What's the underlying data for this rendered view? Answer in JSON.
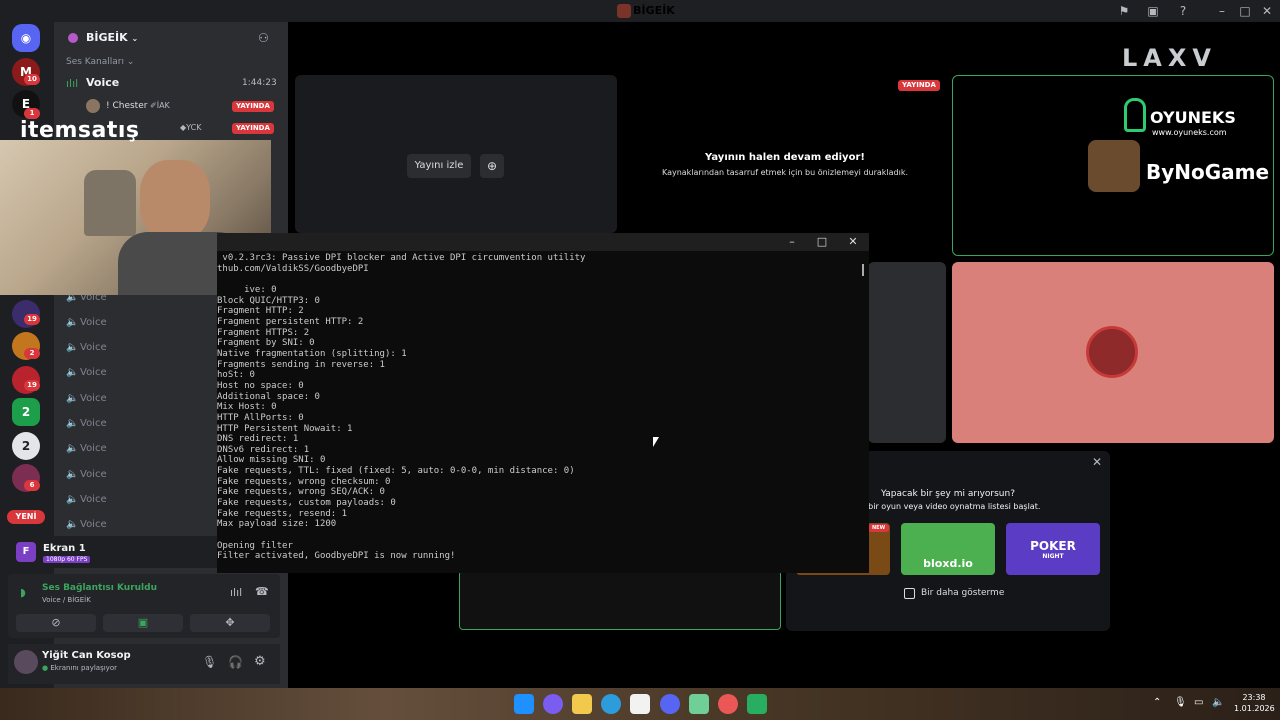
{
  "window": {
    "title": "BİGEİK"
  },
  "rail": {
    "badges": [
      "10",
      "1",
      "19",
      "2",
      "19",
      "2",
      "6"
    ],
    "new_label": "YENİ",
    "e_label": "E",
    "f_label": "F"
  },
  "sidebar": {
    "server_name": "BİGEİK",
    "section": "Ses Kanalları",
    "voice_main": "Voice",
    "timer": "1:44:23",
    "members": [
      {
        "name": "! Chester",
        "tag": "İAK",
        "badge": "YAYINDA"
      },
      {
        "tag": "YCK",
        "badge": "YAYINDA"
      }
    ],
    "voice_channels": [
      "Voice",
      "Voice",
      "Voice",
      "Voice",
      "Voice",
      "Voice",
      "Voice",
      "Voice",
      "Voice",
      "Voice"
    ]
  },
  "stream_card": {
    "title": "Ekran 1",
    "quality": "1080p 60 FPS"
  },
  "connection": {
    "status": "Ses Bağlantısı Kuruldu",
    "location": "Voice / BİGEİK"
  },
  "user": {
    "name": "Yiğit Can Kosop",
    "status": "Ekranını paylaşıyor"
  },
  "webcam_overlay": {
    "logo": "itemsatış"
  },
  "stage": {
    "watch_label": "Yayını izle",
    "live_badge": "YAYINDA",
    "paused_title": "Yayının halen devam ediyor!",
    "paused_sub": "Kaynaklarından tasarruf etmek için bu önizlemeyi durakladık.",
    "brand_laxv": "LAXV",
    "brand_oyuneks": "OYUNEKS",
    "brand_oyuneks_url": "www.oyuneks.com",
    "brand_bynogame": "ByNoGame"
  },
  "activity": {
    "title": "Yapacak bir şey mi arıyorsun?",
    "subtitle": "en bir oyun veya video oynatma listesi başlat.",
    "new_tag": "NEW",
    "cards": [
      {
        "label": "bloxd.io",
        "color": "#4caf50"
      },
      {
        "label": "POKER",
        "sub": "NIGHT",
        "color": "#5b3cc4"
      }
    ],
    "dont_show": "Bir daha gösterme"
  },
  "console": {
    "lines": [
      " v0.2.3rc3: Passive DPI blocker and Active DPI circumvention utility",
      "thub.com/ValdikSS/GoodbyeDPI",
      "",
      "     ive: 0",
      "Block QUIC/HTTP3: 0",
      "Fragment HTTP: 2",
      "Fragment persistent HTTP: 2",
      "Fragment HTTPS: 2",
      "Fragment by SNI: 0",
      "Native fragmentation (splitting): 1",
      "Fragments sending in reverse: 1",
      "hoSt: 0",
      "Host no space: 0",
      "Additional space: 0",
      "Mix Host: 0",
      "HTTP AllPorts: 0",
      "HTTP Persistent Nowait: 1",
      "DNS redirect: 1",
      "DNSv6 redirect: 1",
      "Allow missing SNI: 0",
      "Fake requests, TTL: fixed (fixed: 5, auto: 0-0-0, min distance: 0)",
      "Fake requests, wrong checksum: 0",
      "Fake requests, wrong SEQ/ACK: 0",
      "Fake requests, custom payloads: 0",
      "Fake requests, resend: 1",
      "Max payload size: 1200",
      "",
      "Opening filter",
      "Filter activated, GoodbyeDPI is now running!"
    ]
  },
  "taskbar": {
    "time": "23:38",
    "date": "1.01.2026"
  },
  "colors": {
    "live_red": "#da373c",
    "connected_green": "#3ba55d",
    "sidebar_bg": "#2b2d31"
  }
}
